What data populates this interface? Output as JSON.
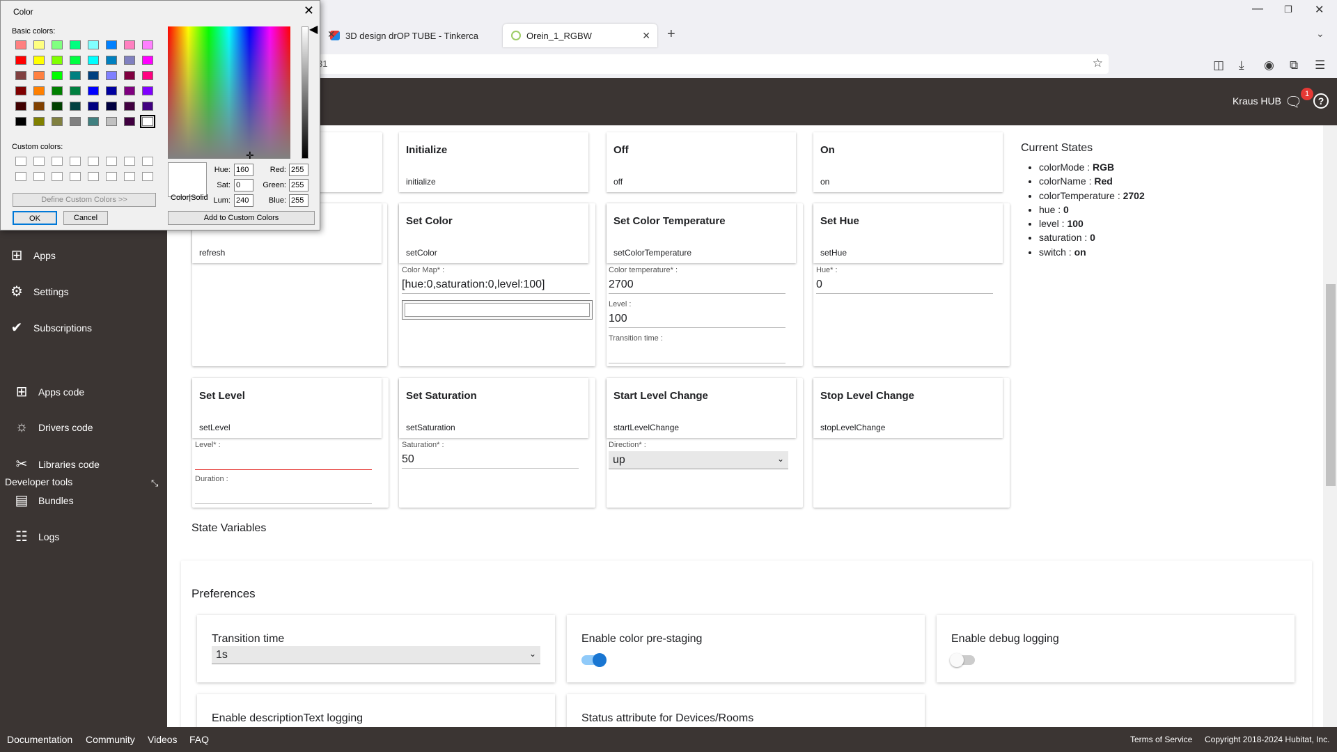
{
  "browser": {
    "tabs": [
      {
        "label": "3D design drOP TUBE - Tinkerca"
      },
      {
        "label": "Orein_1_RGBW"
      }
    ],
    "url_fragment": "31"
  },
  "header": {
    "hub_name": "Kraus HUB",
    "notification_count": "1"
  },
  "sidebar": {
    "items": [
      {
        "label": "Apps",
        "icon": "apps-icon"
      },
      {
        "label": "Settings",
        "icon": "settings-icon"
      },
      {
        "label": "Subscriptions",
        "icon": "subscriptions-icon"
      }
    ],
    "developer_tools": "Developer tools",
    "dev_items": [
      {
        "label": "Apps code"
      },
      {
        "label": "Drivers code"
      },
      {
        "label": "Libraries code"
      },
      {
        "label": "Bundles"
      },
      {
        "label": "Logs"
      }
    ]
  },
  "commands": {
    "row1": [
      {
        "title": "Initialize",
        "sub": "initialize"
      },
      {
        "title": "Off",
        "sub": "off"
      },
      {
        "title": "On",
        "sub": "on"
      }
    ],
    "refresh": {
      "sub": "refresh"
    },
    "set_color": {
      "title": "Set Color",
      "sub": "setColor",
      "map_label": "Color Map* :",
      "map_value": "[hue:0,saturation:0,level:100]"
    },
    "set_ct": {
      "title": "Set Color Temperature",
      "sub": "setColorTemperature",
      "ct_label": "Color temperature* :",
      "ct_value": "2700",
      "level_label": "Level :",
      "level_value": "100",
      "tt_label": "Transition time :"
    },
    "set_hue": {
      "title": "Set Hue",
      "sub": "setHue",
      "hue_label": "Hue* :",
      "hue_value": "0"
    },
    "set_level": {
      "title": "Set Level",
      "sub": "setLevel",
      "level_label": "Level* :",
      "duration_label": "Duration :"
    },
    "set_sat": {
      "title": "Set Saturation",
      "sub": "setSaturation",
      "sat_label": "Saturation* :",
      "sat_value": "50"
    },
    "start_lc": {
      "title": "Start Level Change",
      "sub": "startLevelChange",
      "dir_label": "Direction* :",
      "dir_value": "up"
    },
    "stop_lc": {
      "title": "Stop Level Change",
      "sub": "stopLevelChange"
    }
  },
  "states": {
    "title": "Current States",
    "items": [
      {
        "k": "colorMode",
        "v": "RGB"
      },
      {
        "k": "colorName",
        "v": "Red"
      },
      {
        "k": "colorTemperature",
        "v": "2702"
      },
      {
        "k": "hue",
        "v": "0"
      },
      {
        "k": "level",
        "v": "100"
      },
      {
        "k": "saturation",
        "v": "0"
      },
      {
        "k": "switch",
        "v": "on"
      }
    ]
  },
  "state_variables": "State Variables",
  "preferences": {
    "title": "Preferences",
    "transition_label": "Transition time",
    "transition_value": "1s",
    "prestage_label": "Enable color pre-staging",
    "prestage_on": true,
    "debug_label": "Enable debug logging",
    "debug_on": false,
    "desc_label": "Enable descriptionText logging",
    "status_label": "Status attribute for Devices/Rooms"
  },
  "footer": {
    "links": [
      "Documentation",
      "Community",
      "Videos",
      "FAQ"
    ],
    "terms": "Terms of Service",
    "copyright": "Copyright 2018-2024 Hubitat, Inc."
  },
  "color_dialog": {
    "title": "Color",
    "basic_label": "Basic colors:",
    "custom_label": "Custom colors:",
    "define_btn": "Define Custom Colors >>",
    "ok": "OK",
    "cancel": "Cancel",
    "color_solid": "Color|Solid",
    "add_custom": "Add to Custom Colors",
    "hue_label": "Hue:",
    "hue": "160",
    "sat_label": "Sat:",
    "sat": "0",
    "lum_label": "Lum:",
    "lum": "240",
    "red_label": "Red:",
    "red": "255",
    "green_label": "Green:",
    "green": "255",
    "blue_label": "Blue:",
    "blue": "255",
    "basic_colors": [
      "#ff8080",
      "#ffff80",
      "#80ff80",
      "#00ff80",
      "#80ffff",
      "#0080ff",
      "#ff80c0",
      "#ff80ff",
      "#ff0000",
      "#ffff00",
      "#80ff00",
      "#00ff40",
      "#00ffff",
      "#0080c0",
      "#8080c0",
      "#ff00ff",
      "#804040",
      "#ff8040",
      "#00ff00",
      "#008080",
      "#004080",
      "#8080ff",
      "#800040",
      "#ff0080",
      "#800000",
      "#ff8000",
      "#008000",
      "#008040",
      "#0000ff",
      "#0000a0",
      "#800080",
      "#8000ff",
      "#400000",
      "#804000",
      "#004000",
      "#004040",
      "#000080",
      "#000040",
      "#400040",
      "#400080",
      "#000000",
      "#808000",
      "#808040",
      "#808080",
      "#408080",
      "#c0c0c0",
      "#400040",
      "#ffffff"
    ]
  }
}
